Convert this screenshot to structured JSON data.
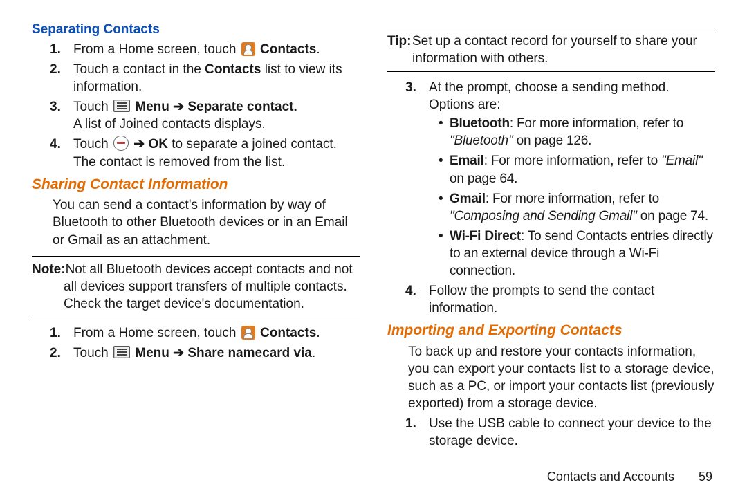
{
  "left": {
    "h_sep": "Separating Contacts",
    "sep_1a": "From a Home screen, touch ",
    "sep_1c": "Contacts",
    "sep_2": "Touch a contact in the ",
    "sep_2b": "Contacts",
    "sep_2c": " list to view its information.",
    "sep_3a": "Touch ",
    "sep_3b": "Menu",
    "sep_3c": "Separate contact.",
    "sep_3d": "A list of Joined contacts displays.",
    "sep_4a": "Touch ",
    "sep_4b": "OK",
    "sep_4c": " to separate a joined contact. The contact is removed from the list.",
    "h_share": "Sharing Contact Information",
    "share_intro": "You can send a contact's information by way of Bluetooth to other Bluetooth devices or in an Email or Gmail as an attachment.",
    "note_lbl": "Note:",
    "note_body": "Not all Bluetooth devices accept contacts and not all devices support transfers of multiple contacts. Check the target device's documentation.",
    "share_1a": "From a Home screen, touch ",
    "share_1c": "Contacts",
    "share_2a": "Touch ",
    "share_2b": "Menu",
    "share_2c": "Share namecard via"
  },
  "right": {
    "tip_lbl": "Tip:",
    "tip_body": "Set up a contact record for yourself to share your information with others.",
    "r3": "At the prompt, choose a sending method. Options are:",
    "bt_b": "Bluetooth",
    "bt_t": ": For more information, refer to ",
    "bt_i": "\"Bluetooth\"",
    "bt_p": "on page 126.",
    "em_b": "Email",
    "em_t": ": For more information, refer to ",
    "em_i": "\"Email\"",
    "em_p": "on page 64.",
    "gm_b": "Gmail",
    "gm_t": ": For more information, refer to ",
    "gm_i": "\"Composing and Sending Gmail\"",
    "gm_p": "on page 74.",
    "wf_b": "Wi-Fi Direct",
    "wf_t": ": To send Contacts entries directly to an external device through a Wi-Fi connection.",
    "r4": "Follow the prompts to send the contact information.",
    "h_imp": "Importing and Exporting Contacts",
    "imp_intro": "To back up and restore your contacts information, you can export your contacts list to a storage device, such as a PC, or import your contacts list (previously exported) from a storage device.",
    "imp_1": "Use the USB cable to connect your device to the storage device."
  },
  "footer": {
    "section": "Contacts and Accounts",
    "page": "59"
  },
  "arrow": "➔"
}
